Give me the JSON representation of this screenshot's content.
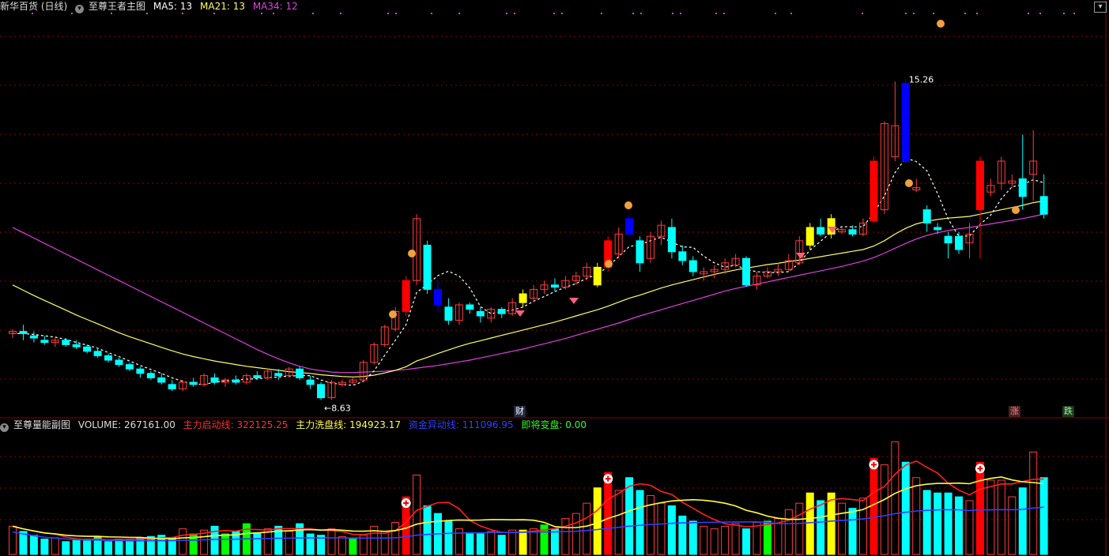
{
  "main_panel": {
    "title": "新华百货 (日线)",
    "indicator_name": "至尊王者主图",
    "ma5": "MA5: 13",
    "ma21": "MA21: 13",
    "ma34": "MA34: 12",
    "low_label": "8.63",
    "high_label": "15.26",
    "badge_cai": "财",
    "badge_zhang": "涨",
    "badge_die": "跌"
  },
  "sub_panel": {
    "indicator_name": "至尊量能副图",
    "volume": "VOLUME: 267161.00",
    "line1": "主力启动线: 322125.25",
    "line2": "主力洗盘线: 194923.17",
    "line3": "资金异动线: 111096.95",
    "line4": "即将变盘: 0.00"
  },
  "colors": {
    "background": "#000000",
    "up": "#ff3c3c",
    "down": "#00ffff",
    "ma5": "#ffffff",
    "ma21": "#ffff66",
    "ma34": "#e040e0",
    "strong_up": "#ff0000",
    "strong_down": "#0000ff",
    "signal_yellow": "#ffff00",
    "signal_green": "#00ff00",
    "grid": "#8b0000"
  },
  "chart_data": {
    "type": "candlestick",
    "ylim": [
      8.0,
      16.5
    ],
    "ohlc": [
      [
        9.6,
        9.7,
        9.5,
        9.65
      ],
      [
        9.65,
        9.8,
        9.45,
        9.6
      ],
      [
        9.55,
        9.65,
        9.4,
        9.5
      ],
      [
        9.45,
        9.55,
        9.35,
        9.4
      ],
      [
        9.4,
        9.5,
        9.3,
        9.45
      ],
      [
        9.45,
        9.5,
        9.3,
        9.35
      ],
      [
        9.35,
        9.45,
        9.25,
        9.3
      ],
      [
        9.3,
        9.35,
        9.15,
        9.2
      ],
      [
        9.2,
        9.25,
        9.05,
        9.1
      ],
      [
        9.1,
        9.15,
        8.95,
        9.0
      ],
      [
        9.0,
        9.05,
        8.85,
        8.9
      ],
      [
        8.9,
        8.95,
        8.75,
        8.8
      ],
      [
        8.8,
        8.85,
        8.6,
        8.7
      ],
      [
        8.7,
        8.75,
        8.55,
        8.6
      ],
      [
        8.6,
        8.7,
        8.45,
        8.5
      ],
      [
        8.45,
        8.55,
        8.3,
        8.35
      ],
      [
        8.35,
        8.55,
        8.3,
        8.5
      ],
      [
        8.5,
        8.6,
        8.4,
        8.45
      ],
      [
        8.45,
        8.7,
        8.4,
        8.65
      ],
      [
        8.6,
        8.7,
        8.45,
        8.5
      ],
      [
        8.5,
        8.6,
        8.4,
        8.55
      ],
      [
        8.55,
        8.65,
        8.45,
        8.5
      ],
      [
        8.5,
        8.7,
        8.45,
        8.65
      ],
      [
        8.65,
        8.75,
        8.55,
        8.6
      ],
      [
        8.6,
        8.8,
        8.55,
        8.75
      ],
      [
        8.7,
        8.8,
        8.55,
        8.65
      ],
      [
        8.65,
        8.85,
        8.6,
        8.8
      ],
      [
        8.8,
        8.85,
        8.55,
        8.6
      ],
      [
        8.55,
        8.65,
        8.35,
        8.45
      ],
      [
        8.45,
        8.5,
        8.1,
        8.15
      ],
      [
        8.15,
        8.55,
        8.1,
        8.5
      ],
      [
        8.45,
        8.55,
        8.4,
        8.5
      ],
      [
        8.5,
        8.6,
        8.45,
        8.55
      ],
      [
        8.55,
        9.0,
        8.5,
        8.95
      ],
      [
        8.95,
        9.4,
        8.9,
        9.35
      ],
      [
        9.35,
        9.8,
        9.3,
        9.75
      ],
      [
        9.7,
        10.2,
        9.65,
        10.1
      ],
      [
        10.1,
        10.9,
        10.0,
        10.8
      ],
      [
        10.8,
        12.3,
        10.7,
        12.2
      ],
      [
        11.6,
        11.7,
        10.5,
        10.6
      ],
      [
        10.6,
        10.8,
        10.1,
        10.25
      ],
      [
        10.2,
        10.4,
        9.8,
        9.9
      ],
      [
        9.9,
        10.3,
        9.8,
        10.25
      ],
      [
        10.25,
        10.3,
        10.05,
        10.15
      ],
      [
        10.1,
        10.2,
        9.85,
        10.0
      ],
      [
        9.95,
        10.2,
        9.85,
        10.15
      ],
      [
        10.15,
        10.2,
        9.95,
        10.05
      ],
      [
        10.05,
        10.4,
        10.0,
        10.3
      ],
      [
        10.3,
        10.6,
        10.2,
        10.5
      ],
      [
        10.4,
        10.7,
        10.3,
        10.6
      ],
      [
        10.6,
        10.8,
        10.5,
        10.7
      ],
      [
        10.7,
        10.85,
        10.55,
        10.65
      ],
      [
        10.65,
        10.9,
        10.6,
        10.8
      ],
      [
        10.8,
        11.0,
        10.7,
        10.9
      ],
      [
        10.9,
        11.2,
        10.8,
        11.1
      ],
      [
        10.7,
        11.2,
        10.65,
        11.1
      ],
      [
        11.1,
        11.8,
        11.0,
        11.7
      ],
      [
        11.4,
        12.0,
        11.3,
        11.85
      ],
      [
        11.85,
        12.3,
        11.8,
        12.2
      ],
      [
        11.7,
        11.8,
        11.0,
        11.2
      ],
      [
        11.3,
        11.9,
        11.2,
        11.8
      ],
      [
        11.8,
        12.15,
        11.6,
        12.05
      ],
      [
        12.0,
        12.2,
        11.3,
        11.45
      ],
      [
        11.45,
        11.6,
        11.15,
        11.25
      ],
      [
        11.25,
        11.35,
        10.9,
        11.0
      ],
      [
        10.95,
        11.1,
        10.8,
        11.0
      ],
      [
        11.0,
        11.15,
        10.85,
        11.05
      ],
      [
        11.05,
        11.3,
        10.95,
        11.2
      ],
      [
        11.15,
        11.4,
        11.1,
        11.3
      ],
      [
        11.3,
        11.35,
        10.65,
        10.7
      ],
      [
        10.7,
        11.0,
        10.6,
        10.9
      ],
      [
        10.9,
        11.1,
        10.85,
        11.0
      ],
      [
        11.0,
        11.2,
        10.9,
        11.05
      ],
      [
        11.05,
        11.4,
        11.0,
        11.25
      ],
      [
        11.2,
        11.8,
        11.15,
        11.7
      ],
      [
        11.6,
        12.1,
        11.5,
        12.0
      ],
      [
        12.0,
        12.2,
        11.8,
        11.85
      ],
      [
        11.85,
        12.3,
        11.75,
        12.2
      ],
      [
        11.9,
        12.0,
        11.85,
        11.95
      ],
      [
        11.95,
        12.05,
        11.8,
        11.85
      ],
      [
        11.85,
        12.2,
        11.8,
        12.1
      ],
      [
        12.15,
        13.6,
        12.1,
        13.5
      ],
      [
        12.4,
        14.4,
        12.3,
        14.35
      ],
      [
        13.6,
        15.3,
        13.5,
        14.3
      ],
      [
        15.26,
        15.35,
        13.45,
        13.5
      ],
      [
        12.85,
        13.1,
        12.8,
        12.9
      ],
      [
        12.4,
        12.5,
        11.9,
        12.1
      ],
      [
        12.0,
        12.1,
        11.85,
        11.95
      ],
      [
        11.8,
        11.9,
        11.3,
        11.65
      ],
      [
        11.8,
        11.9,
        11.4,
        11.5
      ],
      [
        11.65,
        12.1,
        11.3,
        11.85
      ],
      [
        12.4,
        13.6,
        11.3,
        13.5
      ],
      [
        12.8,
        13.1,
        12.7,
        12.95
      ],
      [
        13.0,
        13.6,
        12.85,
        13.5
      ],
      [
        13.0,
        13.2,
        12.9,
        13.05
      ],
      [
        13.1,
        14.1,
        12.4,
        12.7
      ],
      [
        13.2,
        14.2,
        12.6,
        13.5
      ],
      [
        12.7,
        13.2,
        12.2,
        12.3
      ]
    ],
    "ma5": [
      9.6,
      9.6,
      9.58,
      9.55,
      9.52,
      9.47,
      9.4,
      9.34,
      9.27,
      9.17,
      9.08,
      8.98,
      8.88,
      8.79,
      8.7,
      8.6,
      8.52,
      8.46,
      8.45,
      8.5,
      8.53,
      8.55,
      8.57,
      8.58,
      8.6,
      8.62,
      8.64,
      8.65,
      8.65,
      8.55,
      8.48,
      8.45,
      8.43,
      8.52,
      8.76,
      9.11,
      9.45,
      9.8,
      10.53,
      10.71,
      10.91,
      11.01,
      10.9,
      10.63,
      10.21,
      10.05,
      10.1,
      10.13,
      10.2,
      10.33,
      10.44,
      10.55,
      10.65,
      10.73,
      10.85,
      10.94,
      11.12,
      11.34,
      11.57,
      11.61,
      11.7,
      11.78,
      11.67,
      11.56,
      11.55,
      11.35,
      11.2,
      11.1,
      11.15,
      11.05,
      11.0,
      10.98,
      10.98,
      11.0,
      11.2,
      11.49,
      11.69,
      11.89,
      12.02,
      12.01,
      12.02,
      12.33,
      12.71,
      13.24,
      13.57,
      13.49,
      13.28,
      12.77,
      12.19,
      11.8,
      11.81,
      12.07,
      12.28,
      12.65,
      12.92,
      12.97,
      13.08,
      13.01
    ],
    "ma21": [
      10.7,
      10.58,
      10.46,
      10.35,
      10.24,
      10.13,
      10.02,
      9.92,
      9.82,
      9.72,
      9.62,
      9.53,
      9.45,
      9.37,
      9.29,
      9.21,
      9.14,
      9.08,
      9.03,
      8.98,
      8.94,
      8.9,
      8.86,
      8.83,
      8.8,
      8.77,
      8.74,
      8.72,
      8.7,
      8.67,
      8.65,
      8.63,
      8.62,
      8.63,
      8.66,
      8.71,
      8.77,
      8.85,
      8.98,
      9.06,
      9.15,
      9.23,
      9.31,
      9.38,
      9.44,
      9.5,
      9.56,
      9.62,
      9.68,
      9.74,
      9.8,
      9.86,
      9.93,
      10.0,
      10.07,
      10.14,
      10.22,
      10.31,
      10.4,
      10.47,
      10.55,
      10.63,
      10.7,
      10.76,
      10.82,
      10.88,
      10.94,
      10.99,
      11.04,
      11.08,
      11.12,
      11.16,
      11.19,
      11.23,
      11.26,
      11.3,
      11.34,
      11.38,
      11.42,
      11.46,
      11.5,
      11.58,
      11.7,
      11.85,
      11.98,
      12.08,
      12.14,
      12.18,
      12.21,
      12.23,
      12.25,
      12.3,
      12.35,
      12.4,
      12.45,
      12.5,
      12.56,
      12.6
    ],
    "ma34": [
      12.0,
      11.88,
      11.76,
      11.64,
      11.52,
      11.4,
      11.28,
      11.16,
      11.04,
      10.92,
      10.8,
      10.68,
      10.56,
      10.44,
      10.32,
      10.2,
      10.08,
      9.96,
      9.84,
      9.72,
      9.6,
      9.48,
      9.36,
      9.24,
      9.13,
      9.03,
      8.94,
      8.86,
      8.8,
      8.76,
      8.73,
      8.72,
      8.72,
      8.73,
      8.74,
      8.75,
      8.77,
      8.79,
      8.82,
      8.85,
      8.88,
      8.92,
      8.96,
      9.0,
      9.05,
      9.1,
      9.15,
      9.2,
      9.25,
      9.31,
      9.37,
      9.43,
      9.49,
      9.56,
      9.63,
      9.7,
      9.77,
      9.84,
      9.92,
      10.0,
      10.07,
      10.14,
      10.21,
      10.28,
      10.35,
      10.42,
      10.49,
      10.56,
      10.62,
      10.67,
      10.72,
      10.77,
      10.82,
      10.87,
      10.92,
      10.97,
      11.02,
      11.07,
      11.12,
      11.18,
      11.24,
      11.32,
      11.42,
      11.53,
      11.64,
      11.74,
      11.82,
      11.88,
      11.93,
      11.97,
      12.0,
      12.04,
      12.08,
      12.12,
      12.16,
      12.2,
      12.25,
      12.3
    ],
    "volume": [
      2.2,
      1.8,
      1.5,
      1.2,
      1.3,
      1.0,
      1.1,
      1.2,
      1.4,
      1.0,
      1.2,
      1.1,
      1.3,
      1.4,
      1.5,
      1.3,
      2.0,
      1.6,
      1.9,
      2.2,
      1.6,
      1.8,
      2.4,
      1.7,
      2.0,
      2.2,
      1.8,
      2.4,
      1.6,
      1.5,
      2.0,
      1.4,
      1.3,
      1.5,
      2.2,
      1.8,
      2.5,
      4.5,
      6.2,
      3.8,
      3.2,
      2.6,
      2.0,
      1.7,
      1.6,
      1.8,
      1.5,
      1.9,
      1.9,
      2.0,
      2.3,
      2.0,
      2.8,
      3.2,
      4.0,
      5.2,
      6.4,
      5.0,
      6.0,
      5.0,
      4.6,
      4.0,
      3.8,
      3.0,
      2.6,
      2.2,
      2.0,
      2.2,
      2.4,
      2.0,
      2.5,
      2.6,
      2.8,
      3.5,
      4.0,
      4.8,
      4.2,
      4.8,
      4.0,
      3.6,
      4.4,
      7.5,
      7.0,
      8.8,
      7.2,
      6.0,
      5.0,
      4.8,
      4.8,
      4.5,
      4.2,
      7.2,
      5.8,
      5.8,
      4.5,
      5.2,
      8.0,
      6.0
    ],
    "vol_ylim": [
      0,
      9.5
    ]
  }
}
